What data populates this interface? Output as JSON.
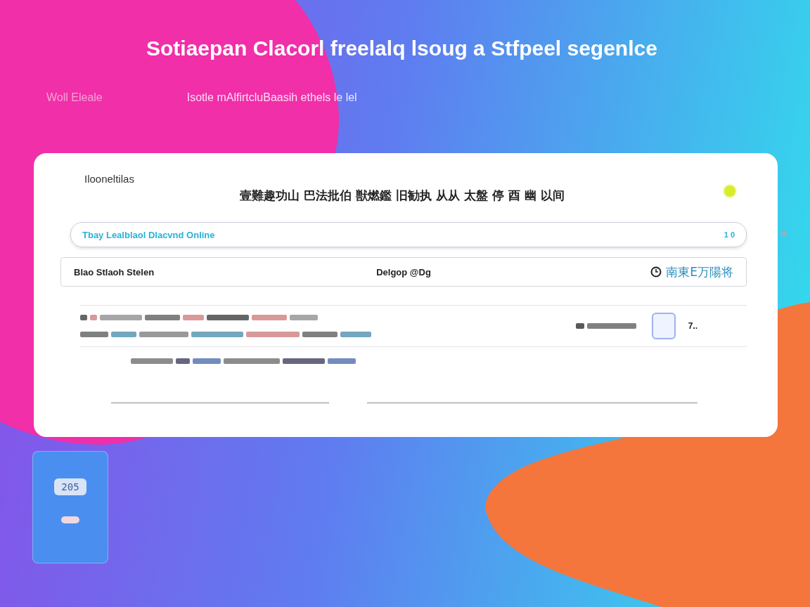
{
  "hero": {
    "title": "Sotiaepan Clacorl freelalq lsoug a Stfpeel segenlce",
    "subtitle_left": "Woll Eleale",
    "subtitle_right": "Isotle mAlfirtcluBaasih ethels le lel"
  },
  "card": {
    "label": "Ilooneltilas",
    "heading": "壹難趣功山 巴法批伯 獣燃鑑 旧勧执 从从 太盤 停 酉 幽 以间",
    "search": {
      "value": "Tbay Lealblaol Dlacvnd Online",
      "badge": "1 0"
    },
    "info_row": {
      "left": "Blao Stlaoh Stelen",
      "middle": "Delgop @Dg",
      "right": "南東E万陽将"
    },
    "chip": "7.."
  },
  "side_card": {
    "display": "205"
  }
}
